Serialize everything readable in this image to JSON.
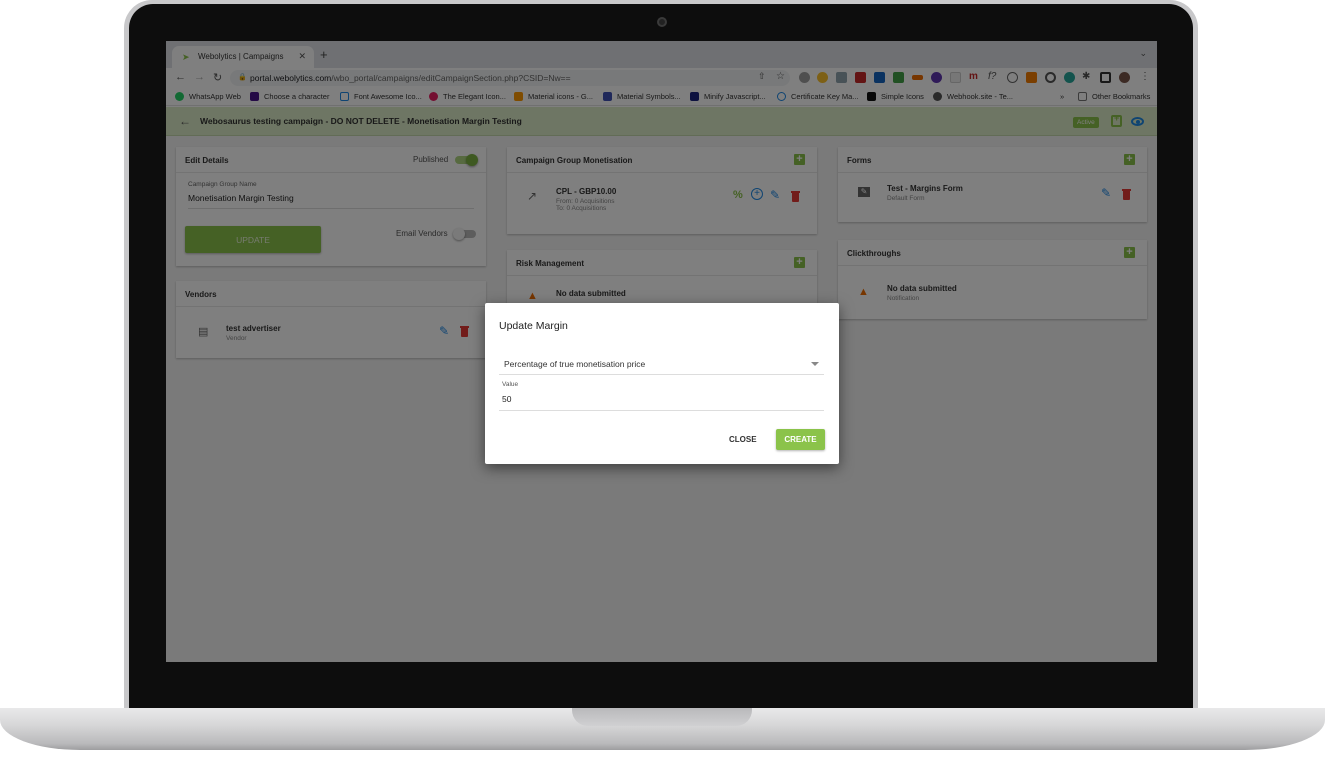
{
  "browser": {
    "tab_title": "Webolytics | Campaigns",
    "url_host": "portal.webolytics.com",
    "url_path": "/wbo_portal/campaigns/editCampaignSection.php?CSID=Nw==",
    "bookmarks": [
      {
        "label": "WhatsApp Web",
        "color": "#25d366"
      },
      {
        "label": "Choose a character",
        "color": "#4a148c"
      },
      {
        "label": "Font Awesome Ico...",
        "color": "#1e88e5"
      },
      {
        "label": "The Elegant Icon...",
        "color": "#e91e63"
      },
      {
        "label": "Material icons - G...",
        "color": "#ff9800"
      },
      {
        "label": "Material Symbols...",
        "color": "#3f51b5"
      },
      {
        "label": "Minify Javascript...",
        "color": "#1a237e"
      },
      {
        "label": "Certificate Key Ma...",
        "color": "#1e88e5"
      },
      {
        "label": "Simple Icons",
        "color": "#111111"
      },
      {
        "label": "Webhook.site - Te...",
        "color": "#555555"
      }
    ],
    "more_bookmarks": "»",
    "other_bookmarks": "Other Bookmarks"
  },
  "app": {
    "title": "Webosaurus testing campaign - DO NOT DELETE - Monetisation Margin Testing",
    "status_badge": "Active",
    "accent_color": "#8bc34a"
  },
  "edit_details": {
    "heading": "Edit Details",
    "published_label": "Published",
    "name_label": "Campaign Group Name",
    "name_value": "Monetisation Margin Testing",
    "update_label": "UPDATE",
    "email_vendors_label": "Email Vendors"
  },
  "vendors": {
    "heading": "Vendors",
    "items": [
      {
        "name": "test advertiser",
        "type": "Vendor"
      }
    ]
  },
  "monetisation": {
    "heading": "Campaign Group Monetisation",
    "items": [
      {
        "title": "CPL - GBP10.00",
        "from": "From: 0 Acquisitions",
        "to": "To: 0 Acquisitions"
      }
    ]
  },
  "risk": {
    "heading": "Risk Management",
    "empty": "No data submitted"
  },
  "forms": {
    "heading": "Forms",
    "items": [
      {
        "name": "Test - Margins Form",
        "sub": "Default Form"
      }
    ]
  },
  "clickthroughs": {
    "heading": "Clickthroughs",
    "empty": "No data submitted",
    "sub": "Notification"
  },
  "modal": {
    "title": "Update Margin",
    "select_value": "Percentage of true monetisation price",
    "value_label": "Value",
    "value": "50",
    "close_label": "CLOSE",
    "create_label": "CREATE"
  }
}
